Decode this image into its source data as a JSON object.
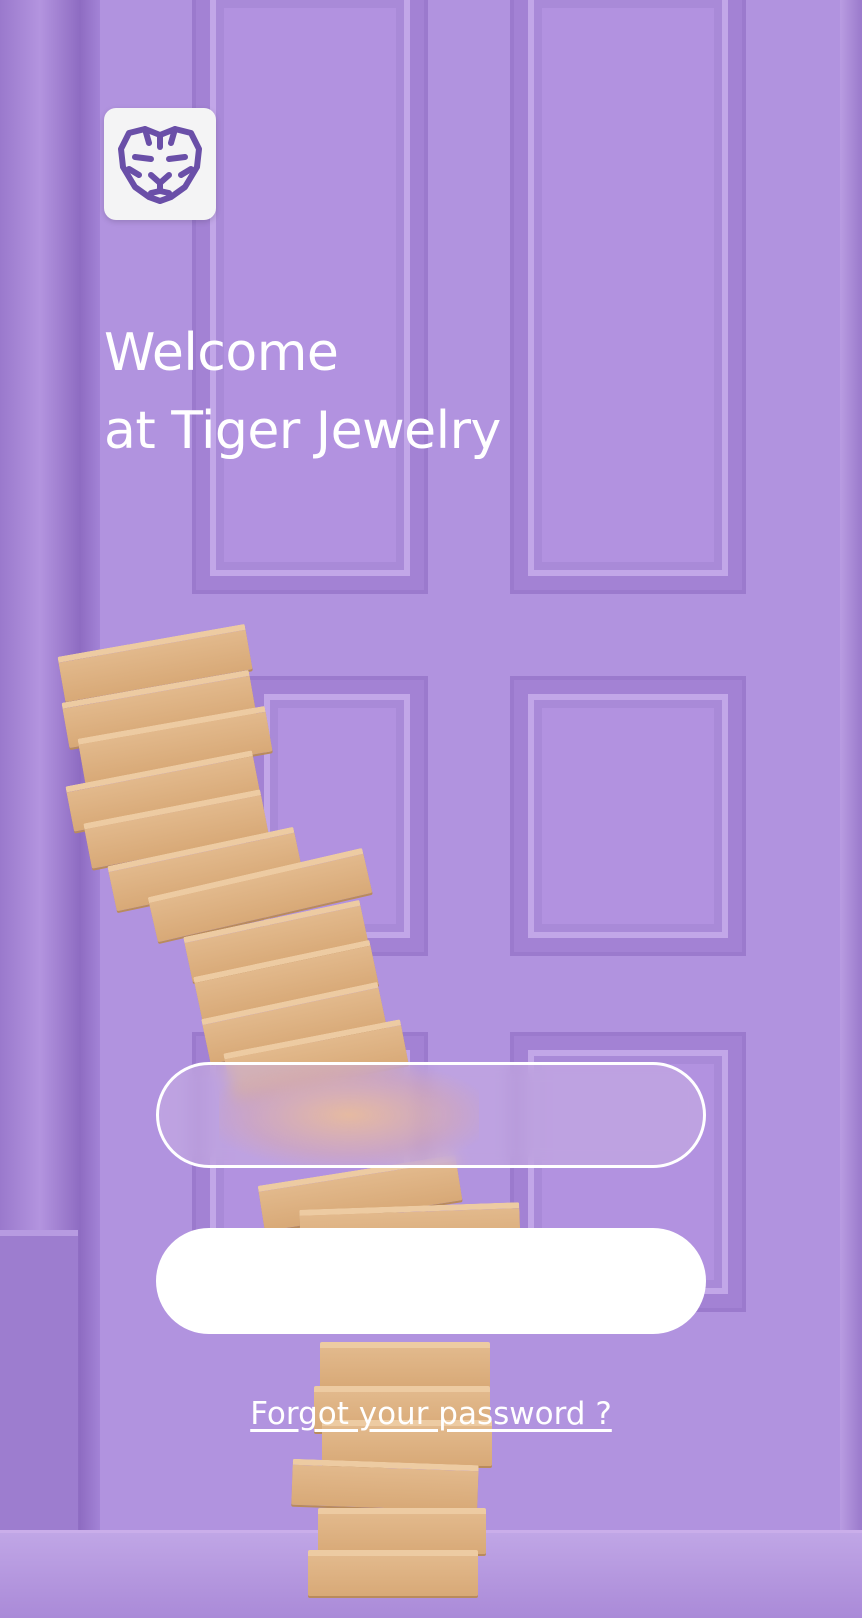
{
  "brand": {
    "logo_icon": "tiger-icon",
    "logo_bg": "#f4f4f5",
    "logo_color": "#6a4fa8"
  },
  "welcome": {
    "line1": "Welcome",
    "line2": "at Tiger Jewelry"
  },
  "login": {
    "email_value": "",
    "password_value": ""
  },
  "links": {
    "forgot_password": "Forgot your password ?"
  },
  "colors": {
    "background": "#b193df",
    "text": "#ffffff"
  }
}
